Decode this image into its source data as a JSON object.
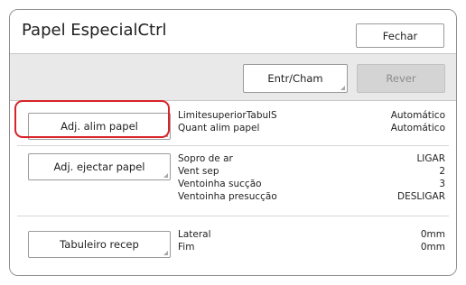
{
  "header": {
    "title": "Papel EspecialCtrl",
    "close_label": "Fechar"
  },
  "toolbar": {
    "entr_cham_label": "Entr/Cham",
    "rever_label": "Rever"
  },
  "sections": [
    {
      "button": "Adj. alim papel",
      "rows": [
        {
          "label": "LimitesuperiorTabulS",
          "value": "Automático"
        },
        {
          "label": "Quant alim papel",
          "value": "Automático"
        }
      ]
    },
    {
      "button": "Adj. ejectar papel",
      "rows": [
        {
          "label": "Sopro de ar",
          "value": "LIGAR"
        },
        {
          "label": "Vent sep",
          "value": "2"
        },
        {
          "label": "Ventoinha sucção",
          "value": "3"
        },
        {
          "label": "Ventoinha presucção",
          "value": "DESLIGAR"
        }
      ]
    },
    {
      "button": "Tabuleiro recep",
      "rows": [
        {
          "label": "Lateral",
          "value": "0mm"
        },
        {
          "label": "Fim",
          "value": "0mm"
        }
      ]
    }
  ],
  "colors": {
    "highlight": "#d8232a"
  }
}
